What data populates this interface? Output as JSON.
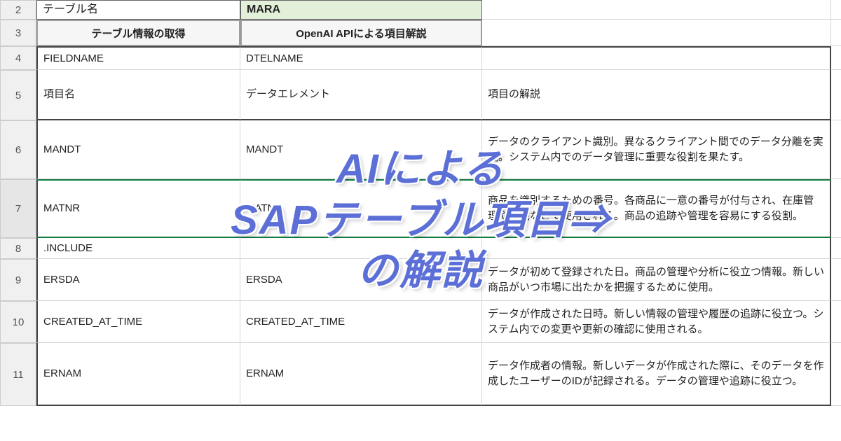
{
  "row_numbers": [
    "2",
    "3",
    "4",
    "5",
    "6",
    "7",
    "8",
    "9",
    "10",
    "11"
  ],
  "header": {
    "table_name_label": "テーブル名",
    "table_name_value": "MARA",
    "btn_fetch": "テーブル情報の取得",
    "btn_ai": "OpenAI APIによる項目解説"
  },
  "columns": {
    "fieldname_tech": "FIELDNAME",
    "dtelname_tech": "DTELNAME",
    "fieldname_jp": "項目名",
    "dtelname_jp": "データエレメント",
    "desc_jp": "項目の解説"
  },
  "rows": [
    {
      "field": "MANDT",
      "dtel": "MANDT",
      "desc": "データのクライアント識別。異なるクライアント間でのデータ分離を実現。システム内でのデータ管理に重要な役割を果たす。"
    },
    {
      "field": "MATNR",
      "dtel": "MATNR",
      "desc": "商品を識別するための番号。各商品に一意の番号が付与され、在庫管理や販売などで使用される。商品の追跡や管理を容易にする役割。"
    },
    {
      "field": ".INCLUDE",
      "dtel": "",
      "desc": ""
    },
    {
      "field": "ERSDA",
      "dtel": "ERSDA",
      "desc": "データが初めて登録された日。商品の管理や分析に役立つ情報。新しい商品がいつ市場に出たかを把握するために使用。"
    },
    {
      "field": "CREATED_AT_TIME",
      "dtel": "CREATED_AT_TIME",
      "desc": "データが作成された日時。新しい情報の管理や履歴の追跡に役立つ。システム内での変更や更新の確認に使用される。"
    },
    {
      "field": "ERNAM",
      "dtel": "ERNAM",
      "desc": "データ作成者の情報。新しいデータが作成された際に、そのデータを作成したユーザーのIDが記録される。データの管理や追跡に役立つ。"
    }
  ],
  "overlay": {
    "line1": "AIによる",
    "line2": "SAPテーブル項目⇒",
    "line3": "の解説"
  }
}
